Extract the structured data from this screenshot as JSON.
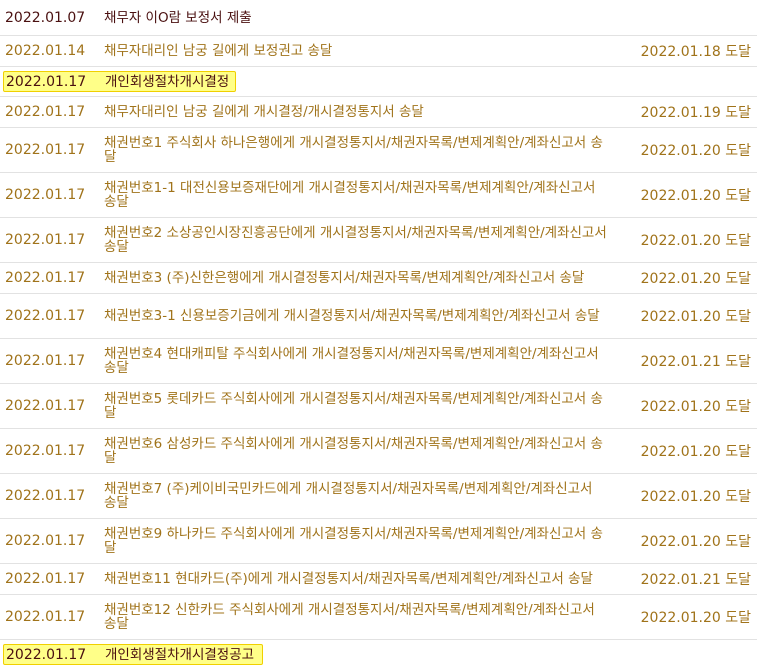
{
  "rows": [
    {
      "date": "2022.01.07",
      "text": "채무자 이O람 보정서 제출",
      "delivered": ""
    },
    {
      "date": "2022.01.14",
      "text": "채무자대리인 남궁 길에게 보정권고 송달",
      "delivered": "2022.01.18 도달"
    },
    {
      "date": "2022.01.17",
      "text": "개인회생절차개시결정",
      "delivered": ""
    },
    {
      "date": "2022.01.17",
      "text": "채무자대리인 남궁 길에게 개시결정/개시결정통지서 송달",
      "delivered": "2022.01.19 도달"
    },
    {
      "date": "2022.01.17",
      "text": "채권번호1 주식회사 하나은행에게 개시결정통지서/채권자목록/변제계획안/계좌신고서 송달",
      "delivered": "2022.01.20 도달"
    },
    {
      "date": "2022.01.17",
      "text": "채권번호1-1 대전신용보증재단에게 개시결정통지서/채권자목록/변제계획안/계좌신고서 송달",
      "delivered": "2022.01.20 도달"
    },
    {
      "date": "2022.01.17",
      "text": "채권번호2 소상공인시장진흥공단에게 개시결정통지서/채권자목록/변제계획안/계좌신고서 송달",
      "delivered": "2022.01.20 도달"
    },
    {
      "date": "2022.01.17",
      "text": "채권번호3 (주)신한은행에게 개시결정통지서/채권자목록/변제계획안/계좌신고서 송달",
      "delivered": "2022.01.20 도달"
    },
    {
      "date": "2022.01.17",
      "text": "채권번호3-1 신용보증기금에게 개시결정통지서/채권자목록/변제계획안/계좌신고서 송달",
      "delivered": "2022.01.20 도달"
    },
    {
      "date": "2022.01.17",
      "text": "채권번호4 현대캐피탈 주식회사에게 개시결정통지서/채권자목록/변제계획안/계좌신고서 송달",
      "delivered": "2022.01.21 도달"
    },
    {
      "date": "2022.01.17",
      "text": "채권번호5 롯데카드 주식회사에게 개시결정통지서/채권자목록/변제계획안/계좌신고서 송달",
      "delivered": "2022.01.20 도달"
    },
    {
      "date": "2022.01.17",
      "text": "채권번호6 삼성카드 주식회사에게 개시결정통지서/채권자목록/변제계획안/계좌신고서 송달",
      "delivered": "2022.01.20 도달"
    },
    {
      "date": "2022.01.17",
      "text": "채권번호7 (주)케이비국민카드에게 개시결정통지서/채권자목록/변제계획안/계좌신고서 송달",
      "delivered": "2022.01.20 도달"
    },
    {
      "date": "2022.01.17",
      "text": "채권번호9 하나카드 주식회사에게 개시결정통지서/채권자목록/변제계획안/계좌신고서 송달",
      "delivered": "2022.01.20 도달"
    },
    {
      "date": "2022.01.17",
      "text": "채권번호11 현대카드(주)에게 개시결정통지서/채권자목록/변제계획안/계좌신고서 송달",
      "delivered": "2022.01.21 도달"
    },
    {
      "date": "2022.01.17",
      "text": "채권번호12 신한카드 주식회사에게 개시결정통지서/채권자목록/변제계획안/계좌신고서 송달",
      "delivered": "2022.01.20 도달"
    },
    {
      "date": "2022.01.17",
      "text": "개인회생절차개시결정공고",
      "delivered": ""
    }
  ]
}
